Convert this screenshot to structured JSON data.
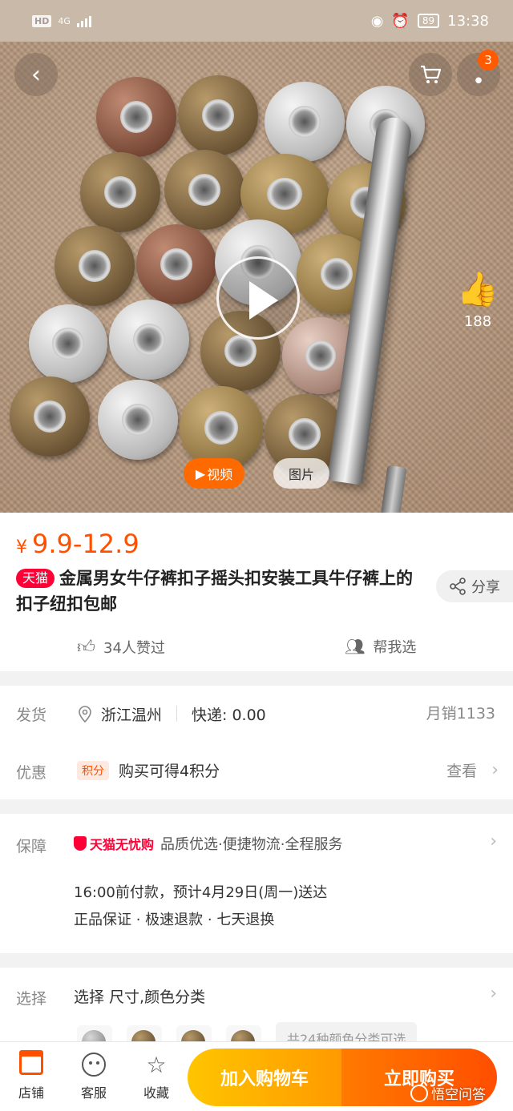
{
  "status_bar": {
    "hd": "HD",
    "network": "4G",
    "battery": "89",
    "time": "13:38"
  },
  "hero": {
    "badge_count": "3",
    "like_count": "188",
    "tab_video": "视频",
    "tab_image": "图片"
  },
  "product": {
    "currency": "¥",
    "price": "9.9-12.9",
    "tmall_tag": "天猫",
    "title": "金属男女牛仔裤扣子摇头扣安装工具牛仔裤上的扣子纽扣包邮",
    "share_label": "分享",
    "likes_text": "34人赞过",
    "help_pick": "帮我选"
  },
  "shipping": {
    "label": "发货",
    "origin": "浙江温州",
    "express": "快递: 0.00",
    "monthly_sales": "月销1133"
  },
  "promo": {
    "label": "优惠",
    "points_tag": "积分",
    "text": "购买可得4积分",
    "view": "查看"
  },
  "guarantee": {
    "label": "保障",
    "badge": "天猫无忧购",
    "text": "品质优选·便捷物流·全程服务",
    "delivery_line1": "16:00前付款，预计4月29日(周一)送达",
    "delivery_line2": "正品保证 · 极速退款 · 七天退换"
  },
  "select": {
    "label": "选择",
    "text": "选择 尺寸,颜色分类",
    "variants_note": "共24种颜色分类可选"
  },
  "bottom_bar": {
    "store": "店铺",
    "service": "客服",
    "favorite": "收藏",
    "add_to_cart": "加入购物车",
    "buy_now": "立即购买"
  },
  "watermark": "悟空问答",
  "colors": {
    "accent": "#ff5000",
    "tmall_red": "#ff0036",
    "cart_yellow": "#ffc500"
  }
}
